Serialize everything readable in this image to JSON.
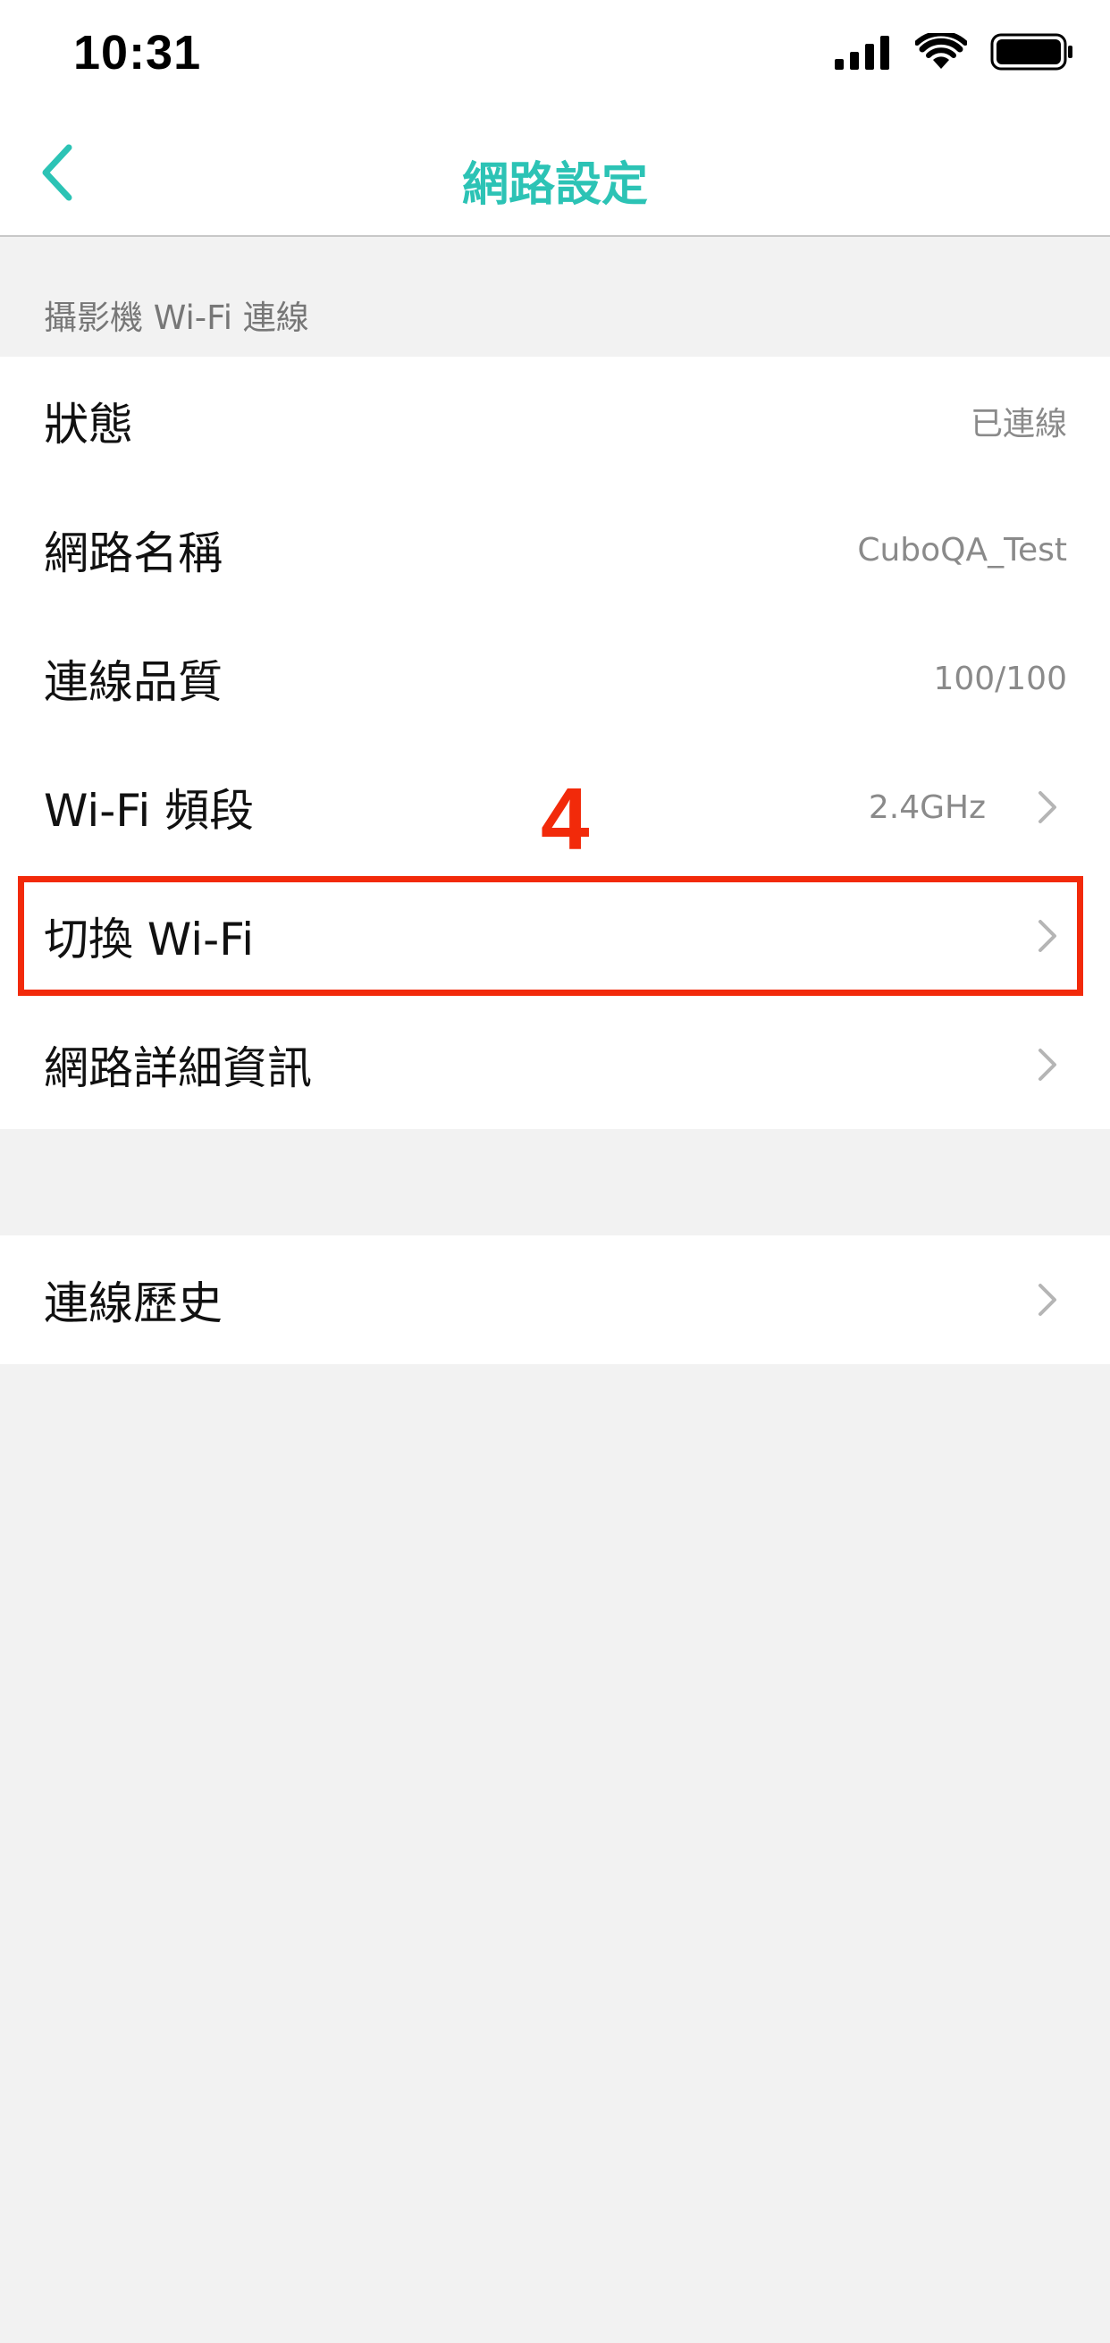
{
  "status_bar": {
    "time": "10:31",
    "icons": [
      "signal-icon",
      "wifi-icon",
      "battery-icon"
    ]
  },
  "nav": {
    "title": "網路設定",
    "back_icon": "chevron-left-icon",
    "accent_color": "#2cc3b5"
  },
  "section": {
    "header": "攝影機 Wi-Fi 連線"
  },
  "rows": [
    {
      "label": "狀態",
      "value": "已連線"
    },
    {
      "label": "網路名稱",
      "value": "CuboQA_Test"
    },
    {
      "label": "連線品質",
      "value": "100/100"
    },
    {
      "label": "Wi-Fi 頻段",
      "value": "2.4GHz"
    },
    {
      "label": "切換 Wi-Fi"
    },
    {
      "label": "網路詳細資訊"
    }
  ],
  "history": {
    "label": "連線歷史"
  },
  "annotation": {
    "number": "4",
    "color": "#f22a0a"
  }
}
